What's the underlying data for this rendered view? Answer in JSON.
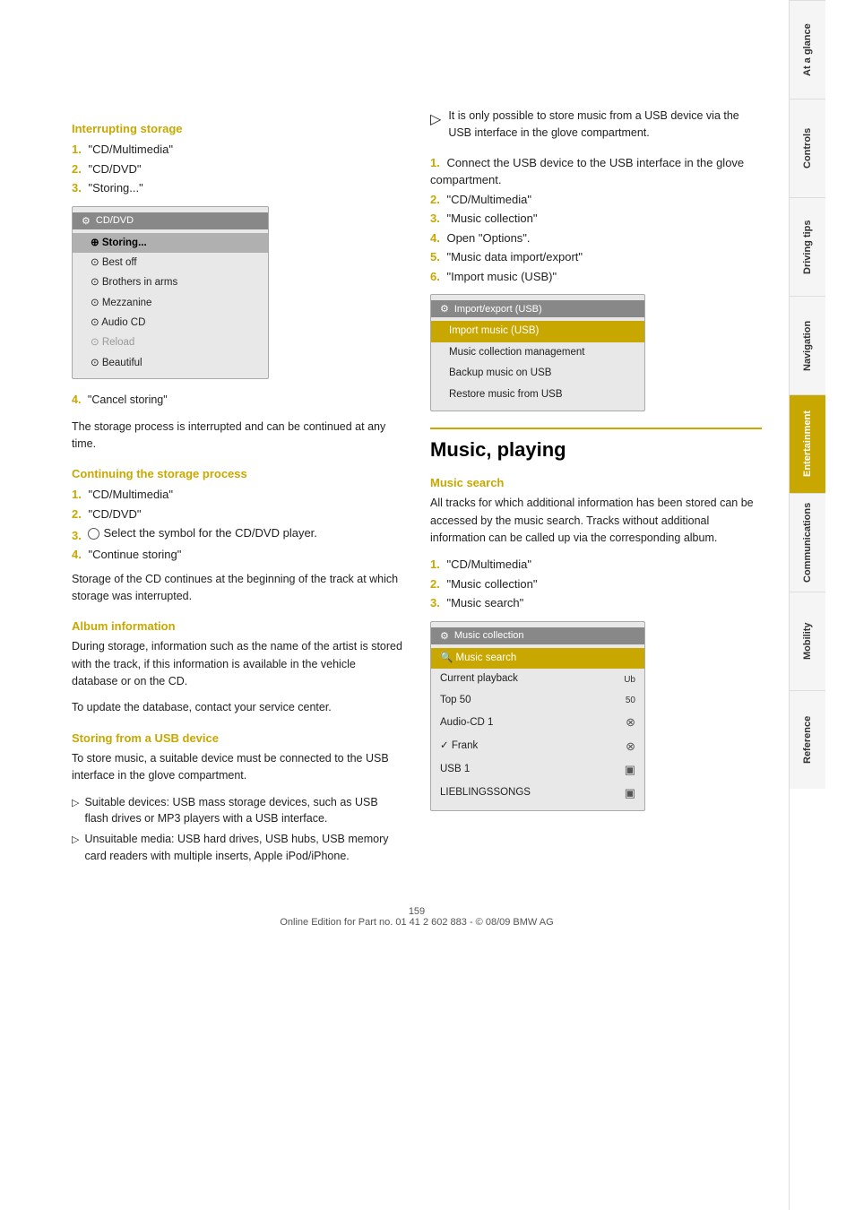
{
  "page": {
    "number": "159",
    "footer_text": "Online Edition for Part no. 01 41 2 602 883 - © 08/09 BMW AG"
  },
  "sidebar": {
    "tabs": [
      {
        "label": "At a glance",
        "active": false
      },
      {
        "label": "Controls",
        "active": false
      },
      {
        "label": "Driving tips",
        "active": false
      },
      {
        "label": "Navigation",
        "active": false
      },
      {
        "label": "Entertainment",
        "active": true
      },
      {
        "label": "Communications",
        "active": false
      },
      {
        "label": "Mobility",
        "active": false
      },
      {
        "label": "Reference",
        "active": false
      }
    ]
  },
  "left_column": {
    "interrupting_storage": {
      "heading": "Interrupting storage",
      "steps": [
        {
          "num": "1.",
          "text": "\"CD/Multimedia\""
        },
        {
          "num": "2.",
          "text": "\"CD/DVD\""
        },
        {
          "num": "3.",
          "text": "\"Storing...\""
        }
      ],
      "menu": {
        "title": "CD/DVD",
        "items": [
          {
            "text": "Storing...",
            "type": "highlighted"
          },
          {
            "text": "Best off",
            "type": "normal"
          },
          {
            "text": "Brothers in arms",
            "type": "normal"
          },
          {
            "text": "Mezzanine",
            "type": "normal"
          },
          {
            "text": "Audio CD",
            "type": "normal"
          },
          {
            "text": "Reload",
            "type": "dimmed"
          },
          {
            "text": "Beautiful",
            "type": "normal"
          }
        ]
      },
      "step4": {
        "num": "4.",
        "text": "\"Cancel storing\""
      },
      "note": "The storage process is interrupted and can be continued at any time."
    },
    "continuing_storage": {
      "heading": "Continuing the storage process",
      "steps": [
        {
          "num": "1.",
          "text": "\"CD/Multimedia\""
        },
        {
          "num": "2.",
          "text": "\"CD/DVD\""
        },
        {
          "num": "3.",
          "text": "Select the symbol for the CD/DVD player."
        },
        {
          "num": "4.",
          "text": "\"Continue storing\""
        }
      ],
      "note": "Storage of the CD continues at the beginning of the track at which storage was interrupted."
    },
    "album_information": {
      "heading": "Album information",
      "para1": "During storage, information such as the name of the artist is stored with the track, if this information is available in the vehicle database or on the CD.",
      "para2": "To update the database, contact your service center."
    },
    "storing_from_usb": {
      "heading": "Storing from a USB device",
      "para1": "To store music, a suitable device must be connected to the USB interface in the glove compartment.",
      "bullets": [
        "Suitable devices: USB mass storage devices, such as USB flash drives or MP3 players with a USB interface.",
        "Unsuitable media: USB hard drives, USB hubs, USB memory card readers with multiple inserts, Apple iPod/iPhone."
      ]
    }
  },
  "right_column": {
    "usb_note": "It is only possible to store music from a USB device via the USB interface in the glove compartment.",
    "steps": [
      {
        "num": "1.",
        "text": "Connect the USB device to the USB interface in the glove compartment."
      },
      {
        "num": "2.",
        "text": "\"CD/Multimedia\""
      },
      {
        "num": "3.",
        "text": "\"Music collection\""
      },
      {
        "num": "4.",
        "text": "Open \"Options\"."
      },
      {
        "num": "5.",
        "text": "\"Music data import/export\""
      },
      {
        "num": "6.",
        "text": "\"Import music (USB)\""
      }
    ],
    "usb_menu": {
      "title": "Import/export (USB)",
      "items": [
        {
          "text": "Import music (USB)",
          "type": "highlighted"
        },
        {
          "text": "Music collection management",
          "type": "normal"
        },
        {
          "text": "Backup music on USB",
          "type": "normal"
        },
        {
          "text": "Restore music from USB",
          "type": "normal"
        }
      ]
    },
    "music_playing": {
      "heading": "Music, playing",
      "music_search": {
        "heading": "Music search",
        "description": "All tracks for which additional information has been stored can be accessed by the music search. Tracks without additional information can be called up via the corresponding album.",
        "steps": [
          {
            "num": "1.",
            "text": "\"CD/Multimedia\""
          },
          {
            "num": "2.",
            "text": "\"Music collection\""
          },
          {
            "num": "3.",
            "text": "\"Music search\""
          }
        ],
        "menu": {
          "title": "Music collection",
          "items": [
            {
              "text": "Music search",
              "icon": "",
              "type": "highlighted"
            },
            {
              "text": "Current playback",
              "icon": "Ub",
              "type": "normal"
            },
            {
              "text": "Top 50",
              "icon": "50",
              "type": "normal"
            },
            {
              "text": "Audio-CD 1",
              "icon": "⊗",
              "type": "normal"
            },
            {
              "text": "✓ Frank",
              "icon": "⊗",
              "type": "normal"
            },
            {
              "text": "USB 1",
              "icon": "▣",
              "type": "normal"
            },
            {
              "text": "LIEBLINGSSONGS",
              "icon": "▣",
              "type": "normal"
            }
          ]
        }
      }
    }
  }
}
